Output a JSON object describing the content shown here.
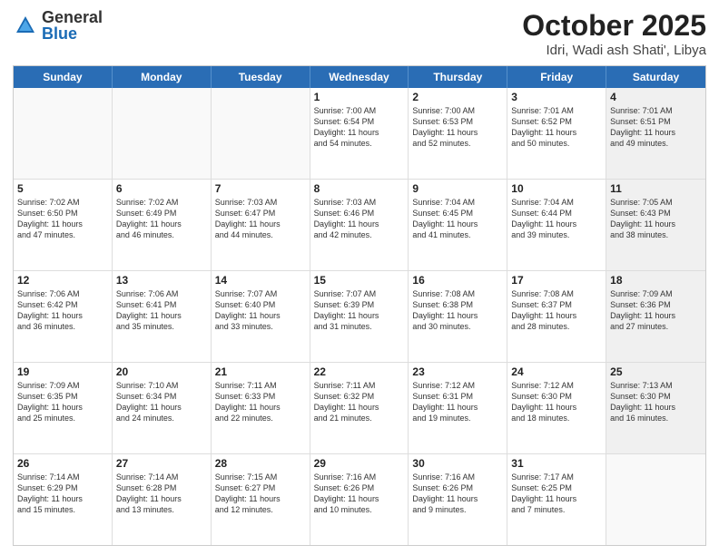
{
  "header": {
    "logo_general": "General",
    "logo_blue": "Blue",
    "title": "October 2025",
    "location": "Idri, Wadi ash Shati', Libya"
  },
  "weekdays": [
    "Sunday",
    "Monday",
    "Tuesday",
    "Wednesday",
    "Thursday",
    "Friday",
    "Saturday"
  ],
  "rows": [
    [
      {
        "day": "",
        "info": "",
        "shaded": false,
        "empty": true
      },
      {
        "day": "",
        "info": "",
        "shaded": false,
        "empty": true
      },
      {
        "day": "",
        "info": "",
        "shaded": false,
        "empty": true
      },
      {
        "day": "1",
        "info": "Sunrise: 7:00 AM\nSunset: 6:54 PM\nDaylight: 11 hours\nand 54 minutes.",
        "shaded": false,
        "empty": false
      },
      {
        "day": "2",
        "info": "Sunrise: 7:00 AM\nSunset: 6:53 PM\nDaylight: 11 hours\nand 52 minutes.",
        "shaded": false,
        "empty": false
      },
      {
        "day": "3",
        "info": "Sunrise: 7:01 AM\nSunset: 6:52 PM\nDaylight: 11 hours\nand 50 minutes.",
        "shaded": false,
        "empty": false
      },
      {
        "day": "4",
        "info": "Sunrise: 7:01 AM\nSunset: 6:51 PM\nDaylight: 11 hours\nand 49 minutes.",
        "shaded": true,
        "empty": false
      }
    ],
    [
      {
        "day": "5",
        "info": "Sunrise: 7:02 AM\nSunset: 6:50 PM\nDaylight: 11 hours\nand 47 minutes.",
        "shaded": false,
        "empty": false
      },
      {
        "day": "6",
        "info": "Sunrise: 7:02 AM\nSunset: 6:49 PM\nDaylight: 11 hours\nand 46 minutes.",
        "shaded": false,
        "empty": false
      },
      {
        "day": "7",
        "info": "Sunrise: 7:03 AM\nSunset: 6:47 PM\nDaylight: 11 hours\nand 44 minutes.",
        "shaded": false,
        "empty": false
      },
      {
        "day": "8",
        "info": "Sunrise: 7:03 AM\nSunset: 6:46 PM\nDaylight: 11 hours\nand 42 minutes.",
        "shaded": false,
        "empty": false
      },
      {
        "day": "9",
        "info": "Sunrise: 7:04 AM\nSunset: 6:45 PM\nDaylight: 11 hours\nand 41 minutes.",
        "shaded": false,
        "empty": false
      },
      {
        "day": "10",
        "info": "Sunrise: 7:04 AM\nSunset: 6:44 PM\nDaylight: 11 hours\nand 39 minutes.",
        "shaded": false,
        "empty": false
      },
      {
        "day": "11",
        "info": "Sunrise: 7:05 AM\nSunset: 6:43 PM\nDaylight: 11 hours\nand 38 minutes.",
        "shaded": true,
        "empty": false
      }
    ],
    [
      {
        "day": "12",
        "info": "Sunrise: 7:06 AM\nSunset: 6:42 PM\nDaylight: 11 hours\nand 36 minutes.",
        "shaded": false,
        "empty": false
      },
      {
        "day": "13",
        "info": "Sunrise: 7:06 AM\nSunset: 6:41 PM\nDaylight: 11 hours\nand 35 minutes.",
        "shaded": false,
        "empty": false
      },
      {
        "day": "14",
        "info": "Sunrise: 7:07 AM\nSunset: 6:40 PM\nDaylight: 11 hours\nand 33 minutes.",
        "shaded": false,
        "empty": false
      },
      {
        "day": "15",
        "info": "Sunrise: 7:07 AM\nSunset: 6:39 PM\nDaylight: 11 hours\nand 31 minutes.",
        "shaded": false,
        "empty": false
      },
      {
        "day": "16",
        "info": "Sunrise: 7:08 AM\nSunset: 6:38 PM\nDaylight: 11 hours\nand 30 minutes.",
        "shaded": false,
        "empty": false
      },
      {
        "day": "17",
        "info": "Sunrise: 7:08 AM\nSunset: 6:37 PM\nDaylight: 11 hours\nand 28 minutes.",
        "shaded": false,
        "empty": false
      },
      {
        "day": "18",
        "info": "Sunrise: 7:09 AM\nSunset: 6:36 PM\nDaylight: 11 hours\nand 27 minutes.",
        "shaded": true,
        "empty": false
      }
    ],
    [
      {
        "day": "19",
        "info": "Sunrise: 7:09 AM\nSunset: 6:35 PM\nDaylight: 11 hours\nand 25 minutes.",
        "shaded": false,
        "empty": false
      },
      {
        "day": "20",
        "info": "Sunrise: 7:10 AM\nSunset: 6:34 PM\nDaylight: 11 hours\nand 24 minutes.",
        "shaded": false,
        "empty": false
      },
      {
        "day": "21",
        "info": "Sunrise: 7:11 AM\nSunset: 6:33 PM\nDaylight: 11 hours\nand 22 minutes.",
        "shaded": false,
        "empty": false
      },
      {
        "day": "22",
        "info": "Sunrise: 7:11 AM\nSunset: 6:32 PM\nDaylight: 11 hours\nand 21 minutes.",
        "shaded": false,
        "empty": false
      },
      {
        "day": "23",
        "info": "Sunrise: 7:12 AM\nSunset: 6:31 PM\nDaylight: 11 hours\nand 19 minutes.",
        "shaded": false,
        "empty": false
      },
      {
        "day": "24",
        "info": "Sunrise: 7:12 AM\nSunset: 6:30 PM\nDaylight: 11 hours\nand 18 minutes.",
        "shaded": false,
        "empty": false
      },
      {
        "day": "25",
        "info": "Sunrise: 7:13 AM\nSunset: 6:30 PM\nDaylight: 11 hours\nand 16 minutes.",
        "shaded": true,
        "empty": false
      }
    ],
    [
      {
        "day": "26",
        "info": "Sunrise: 7:14 AM\nSunset: 6:29 PM\nDaylight: 11 hours\nand 15 minutes.",
        "shaded": false,
        "empty": false
      },
      {
        "day": "27",
        "info": "Sunrise: 7:14 AM\nSunset: 6:28 PM\nDaylight: 11 hours\nand 13 minutes.",
        "shaded": false,
        "empty": false
      },
      {
        "day": "28",
        "info": "Sunrise: 7:15 AM\nSunset: 6:27 PM\nDaylight: 11 hours\nand 12 minutes.",
        "shaded": false,
        "empty": false
      },
      {
        "day": "29",
        "info": "Sunrise: 7:16 AM\nSunset: 6:26 PM\nDaylight: 11 hours\nand 10 minutes.",
        "shaded": false,
        "empty": false
      },
      {
        "day": "30",
        "info": "Sunrise: 7:16 AM\nSunset: 6:26 PM\nDaylight: 11 hours\nand 9 minutes.",
        "shaded": false,
        "empty": false
      },
      {
        "day": "31",
        "info": "Sunrise: 7:17 AM\nSunset: 6:25 PM\nDaylight: 11 hours\nand 7 minutes.",
        "shaded": false,
        "empty": false
      },
      {
        "day": "",
        "info": "",
        "shaded": true,
        "empty": true
      }
    ]
  ]
}
